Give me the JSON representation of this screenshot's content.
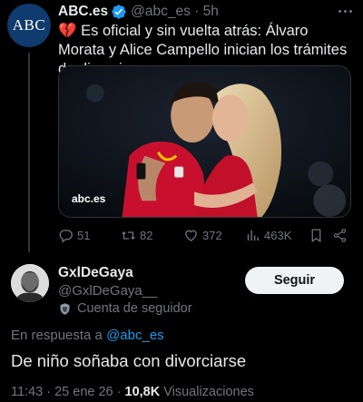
{
  "parent_tweet": {
    "avatar_text": "ABC",
    "author_name": "ABC.es",
    "handle_time": "@abc_es · 5h",
    "text_emoji": "💔",
    "text": " Es oficial y sin vuelta atrás: Álvaro Morata y Alice Campello inician los trámites de divorcio",
    "media_watermark": "abc.es",
    "stats": {
      "replies": "51",
      "retweets": "82",
      "likes": "372",
      "views": "463K"
    }
  },
  "reply_tweet": {
    "author_name": "GxlDeGaya",
    "handle": "@GxlDeGaya__",
    "follower_badge": "Cuenta de seguidor",
    "follow_button": "Seguir",
    "in_reply_prefix": "En respuesta a ",
    "in_reply_mention": "@abc_es",
    "text": "De niño soñaba con divorciarse",
    "time_date": "11:43 · 25 ene 26 · ",
    "views_count": "10,8K",
    "views_label": " Visualizaciones"
  },
  "colors": {
    "background": "#000000",
    "text_primary": "#e7e9ea",
    "text_secondary": "#71767b",
    "accent": "#1d9bf0",
    "abc_avatar": "#0f3b6e"
  }
}
